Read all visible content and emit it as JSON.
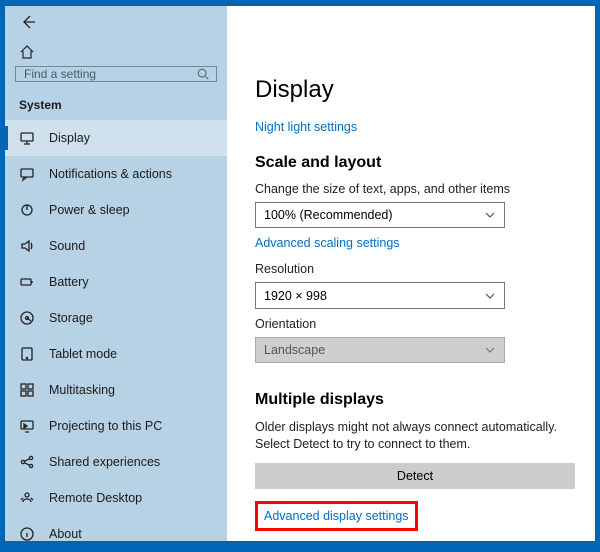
{
  "sidebar": {
    "search_placeholder": "Find a setting",
    "section_label": "System",
    "items": [
      {
        "id": "display",
        "label": "Display",
        "icon": "monitor",
        "selected": true
      },
      {
        "id": "notifications",
        "label": "Notifications & actions",
        "icon": "chat"
      },
      {
        "id": "power",
        "label": "Power & sleep",
        "icon": "power"
      },
      {
        "id": "sound",
        "label": "Sound",
        "icon": "speaker"
      },
      {
        "id": "battery",
        "label": "Battery",
        "icon": "battery"
      },
      {
        "id": "storage",
        "label": "Storage",
        "icon": "drive"
      },
      {
        "id": "tablet",
        "label": "Tablet mode",
        "icon": "tablet"
      },
      {
        "id": "multitask",
        "label": "Multitasking",
        "icon": "windows"
      },
      {
        "id": "projecting",
        "label": "Projecting to this PC",
        "icon": "project"
      },
      {
        "id": "shared",
        "label": "Shared experiences",
        "icon": "share"
      },
      {
        "id": "remote",
        "label": "Remote Desktop",
        "icon": "remote"
      },
      {
        "id": "about",
        "label": "About",
        "icon": "info"
      }
    ]
  },
  "main": {
    "title": "Display",
    "night_light_link": "Night light settings",
    "scale_heading": "Scale and layout",
    "scale_desc": "Change the size of text, apps, and other items",
    "scale_value": "100% (Recommended)",
    "advanced_scaling_link": "Advanced scaling settings",
    "resolution_label": "Resolution",
    "resolution_value": "1920 × 998",
    "orientation_label": "Orientation",
    "orientation_value": "Landscape",
    "multiple_heading": "Multiple displays",
    "multiple_desc": "Older displays might not always connect automatically. Select Detect to try to connect to them.",
    "detect_btn": "Detect",
    "advanced_display_link": "Advanced display settings"
  }
}
